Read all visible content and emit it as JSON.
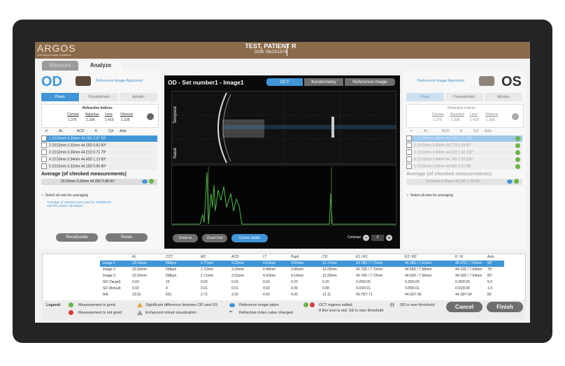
{
  "app": {
    "logo": "ARGOS",
    "logo_sub": "with Alcon Image Guidance"
  },
  "patient": {
    "name": "TEST, PATIENT R",
    "dob": "DOB: 06/23/1975"
  },
  "tabs": {
    "measure": "Measure",
    "analyze": "Analyze"
  },
  "od": {
    "label": "OD",
    "approved": "Reference Image Approved",
    "lens_tabs": [
      "Phakic",
      "Pseudophakic",
      "Aphakic"
    ],
    "refr_title": "Refractive Indices",
    "refr_heads": [
      "Cornea",
      "Aqueous",
      "Lens",
      "Vitreous"
    ],
    "refr_vals": [
      "1.375",
      "1.336",
      "1.410",
      "1.336"
    ],
    "cols": [
      "#",
      "AL",
      "ACD",
      "K",
      "Cyl",
      "Axle"
    ],
    "rows": [
      [
        "1",
        "23.53mm",
        "3.33mm",
        "44.15D",
        "0.67",
        "90°"
      ],
      [
        "2",
        "23.52mm",
        "3.32mm",
        "44.25D",
        "0.82",
        "83°"
      ],
      [
        "3",
        "23.52mm",
        "3.35mm",
        "44.21D",
        "0.71",
        "79°"
      ],
      [
        "4",
        "23.53mm",
        "3.34mm",
        "44.40D",
        "1.13",
        "83°"
      ],
      [
        "5",
        "23.51mm",
        "3.32mm",
        "44.15D",
        "0.89",
        "80°"
      ]
    ],
    "avg_title": "Average (of checked measurements)",
    "avg_row": [
      "23.52mm",
      "3.33mm",
      "44.25D",
      "0.88",
      "81°"
    ],
    "select_all": "Select all sets for averaging",
    "note": "*Average of selected sets used for SUMMARY and IOL power calculation.",
    "recalculate": "Recalculate",
    "reset": "Reset"
  },
  "os": {
    "label": "OS",
    "approved": "Reference Image Approved",
    "lens_tabs": [
      "Phakic",
      "Pseudophakic",
      "Aphakic"
    ],
    "refr_title": "Refractive Indices",
    "refr_heads": [
      "Cornea",
      "Aqueous",
      "Lens",
      "Vitreous"
    ],
    "refr_vals": [
      "1.375",
      "1.336",
      "1.410",
      "1.336"
    ],
    "cols": [
      "#",
      "AL",
      "ACD",
      "K",
      "Cyl",
      "Axle"
    ],
    "rows": [
      [
        "1",
        "23.53mm",
        "3.45mm",
        "44.74D",
        "1.21",
        "103°"
      ],
      [
        "2",
        "23.53mm",
        "3.45mm",
        "44.77D",
        "1.29",
        "97°"
      ],
      [
        "3",
        "23.53mm",
        "3.44mm",
        "44.62D",
        "1.42",
        "102°"
      ],
      [
        "4",
        "23.53mm",
        "3.49mm",
        "44.74D",
        "1.25",
        "100°"
      ],
      [
        "5",
        "23.53mm",
        "3.45mm",
        "44.68D",
        "1.51",
        "98°"
      ]
    ],
    "avg_title": "Average (of checked measurements)",
    "avg_row": [
      "23.53mm",
      "3.45mm",
      "44.72D",
      "1.33",
      "99°"
    ],
    "select_all": "Select all sets for averaging"
  },
  "viewer": {
    "title": "OD - Set number1 - Image1",
    "tabs": [
      "OCT",
      "Keratometry",
      "Reference image"
    ],
    "temporal": "Temporal",
    "nasal": "Nasal",
    "zoom_in": "Zoom In",
    "zoom_out": "Zoom Out",
    "cursor": "Cursor visible",
    "contrast": "Contrast",
    "contrast_val": "0"
  },
  "summary": {
    "cols": [
      "AL",
      "CCT",
      "AD",
      "ACD",
      "LT",
      "Pupil",
      "CD",
      "K1 / R1",
      "K2 / R2",
      "K / R",
      "Axis"
    ],
    "rows": [
      {
        "label": "Image 1",
        "vals": [
          "23.53mm",
          "598μm",
          "2.77mm",
          "3.33mm",
          "4.53mm",
          "3.85mm",
          "12.17mm",
          "43.78D / 7.71mm",
          "44.38D / 7.61mm",
          "44.07D / 7.66mm",
          "90°"
        ]
      },
      {
        "label": "Image 2",
        "vals": [
          "23.52mm",
          "599μm",
          "2.72mm",
          "3.32mm",
          "4.48mm",
          "3.95mm",
          "12.05mm",
          "43.73D / 7.72mm",
          "44.55D / 7.58mm",
          "44.13D / 7.64mm",
          "79°"
        ]
      },
      {
        "label": "Image 3",
        "vals": [
          "23.52mm",
          "598μm",
          "2.71mm",
          "3.31mm",
          "4.50mm",
          "4.10mm",
          "12.20mm",
          "43.74D / 7.72mm",
          "44.60D / 7.56mm",
          "44.15D / 7.64mm",
          "82°"
        ]
      },
      {
        "label": "SD (Target)",
        "vals": [
          "0.03",
          "10",
          "0.03",
          "0.03",
          "0.03",
          "0.20",
          "0.20",
          "0.25/0.05",
          "0.25/0.05",
          "0.25/0.05",
          "5.0"
        ]
      },
      {
        "label": "SD (Actual)",
        "vals": [
          "0.00",
          "4",
          "0.01",
          "0.01",
          "0.02",
          "0.09",
          "0.08",
          "0.03/0.01",
          "0.05/0.01",
          "0.01/0.00",
          "1.4"
        ]
      },
      {
        "label": "A/E",
        "vals": [
          "23.52",
          "601",
          "2.72",
          "3.32",
          "4.50",
          "4.00",
          "12.11",
          "43.75/7.71",
          "44.62/7.56",
          "44.18/7.64",
          "80"
        ]
      }
    ]
  },
  "legend": {
    "title": "Legend:",
    "good": "Measurement is good",
    "notgood": "Measurement is not good",
    "sigdiff": "Significant difference between OD and OS",
    "enhanced": "Enhanced retinal visualization",
    "ref_taken": "Reference image taken",
    "refr_changed": "Refractive index value changed",
    "oct_edited": "OCT regions edited",
    "oct_edited2": "If this icon is red, SD is over threshold",
    "sd_over": "SD is over threshold",
    "sd_icon": "(!)",
    "star": "**"
  },
  "buttons": {
    "cancel": "Cancel",
    "finish": "Finish"
  },
  "colors": {
    "accent": "#3f95d6",
    "brand": "#8b6c4a",
    "good": "#6bb54a",
    "bad": "#d83b3b",
    "warn": "#e8a33a"
  }
}
